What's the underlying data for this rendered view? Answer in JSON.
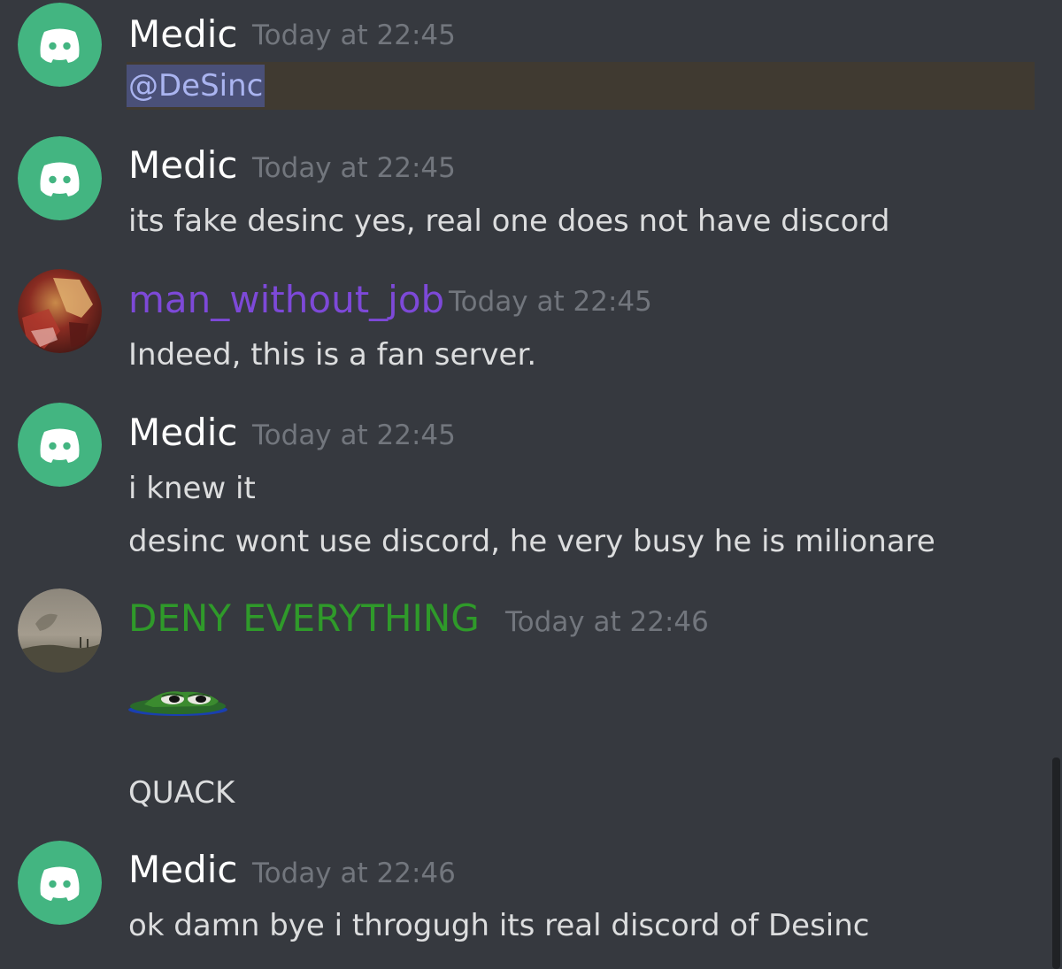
{
  "messages": [
    {
      "author": "Medic",
      "timestamp": "Today at 22:45",
      "avatar_icon": "discord-logo-icon",
      "avatar_color": "#43b581",
      "mention": "@DeSinc"
    },
    {
      "author": "Medic",
      "timestamp": "Today at 22:45",
      "avatar_icon": "discord-logo-icon",
      "avatar_color": "#43b581",
      "lines": [
        "its fake desinc yes, real one does not have discord"
      ]
    },
    {
      "author": "man_without_job",
      "timestamp": "Today at 22:45",
      "author_color": "#7d49d8",
      "avatar_icon": "anime-character-avatar",
      "lines": [
        "Indeed, this is a fan server."
      ]
    },
    {
      "author": "Medic",
      "timestamp": "Today at 22:45",
      "avatar_icon": "discord-logo-icon",
      "avatar_color": "#43b581",
      "lines": [
        "i knew it",
        "desinc wont use discord, he very busy he is milionare"
      ]
    },
    {
      "author": "DENY EVERYTHING",
      "timestamp": "Today at 22:46",
      "author_color": "#2f9a2a",
      "avatar_icon": "landscape-photo-avatar",
      "emoji": "pepe-frog-emoji",
      "lines": [
        "QUACK"
      ]
    },
    {
      "author": "Medic",
      "timestamp": "Today at 22:46",
      "avatar_icon": "discord-logo-icon",
      "avatar_color": "#43b581",
      "lines": [
        "ok damn bye i throgugh its real discord of Desinc"
      ]
    }
  ],
  "colors": {
    "background": "#36393f",
    "text": "#dcddde",
    "timestamp": "#72767d",
    "username_default": "#ffffff",
    "mention_bg": "#4a5078",
    "mention_text": "#aab4f0",
    "mention_row_bg": "#403a31"
  }
}
